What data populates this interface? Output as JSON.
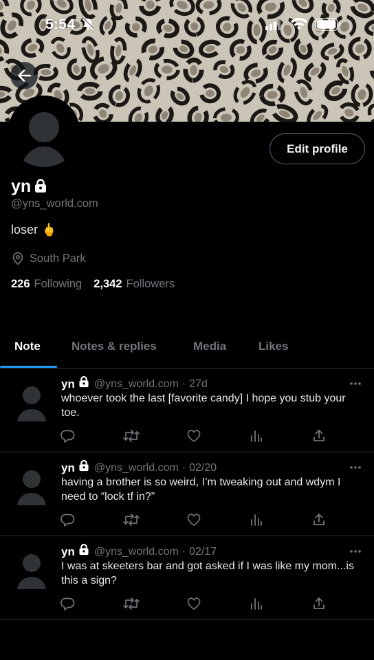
{
  "status_bar": {
    "time": "5:54"
  },
  "profile": {
    "display_name": "yn",
    "handle": "@yns_world.com",
    "bio": "loser",
    "bio_emoji": "🖕",
    "location": "South Park",
    "following_count": "226",
    "following_label": "Following",
    "followers_count": "2,342",
    "followers_label": "Followers",
    "edit_profile_label": "Edit profile"
  },
  "tabs": [
    {
      "label": "Note",
      "active": true
    },
    {
      "label": "Notes & replies",
      "active": false
    },
    {
      "label": "Media",
      "active": false
    },
    {
      "label": "Likes",
      "active": false
    }
  ],
  "posts": [
    {
      "name": "yn",
      "handle": "@yns_world.com",
      "separator": "·",
      "time": "27d",
      "text": "whoever took the last [favorite candy] I hope you stub your toe."
    },
    {
      "name": "yn",
      "handle": "@yns_world.com",
      "separator": "·",
      "time": "02/20",
      "text": "having a brother is so weird, I’m tweaking out and wdym I need to “lock tf in?”"
    },
    {
      "name": "yn",
      "handle": "@yns_world.com",
      "separator": "·",
      "time": "02/17",
      "text": "I was at skeeters bar and got asked if I was like my mom...is this a sign?"
    }
  ],
  "colors": {
    "background": "#000000",
    "text": "#e7e9ea",
    "secondary_text": "#71767b",
    "accent": "#1d9bf0",
    "divider": "#2f3336"
  },
  "icons": {
    "banner": "leopard-print-banner",
    "back": "arrow-left-icon",
    "lock": "lock-icon",
    "location": "location-pin-icon",
    "reply": "reply-icon",
    "repost": "repost-icon",
    "like": "heart-icon",
    "views": "analytics-icon",
    "share": "share-icon",
    "more": "more-dots-icon"
  }
}
